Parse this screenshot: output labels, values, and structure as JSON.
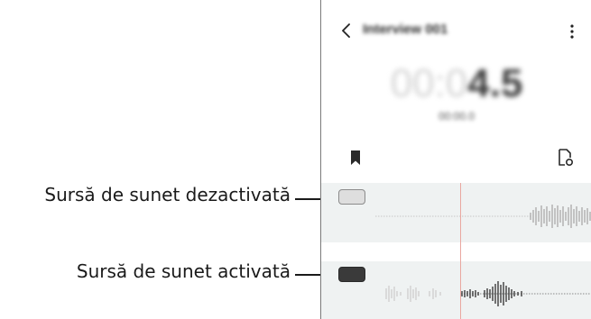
{
  "callouts": [
    {
      "text": "Sursă de sunet dezactivată"
    },
    {
      "text": "Sursă de sunet activată"
    }
  ],
  "app": {
    "title": "Interview 001",
    "timer_dim": "00:0",
    "timer_strong": "4.5",
    "subtime": "00:00.0"
  },
  "icons": {
    "back": "chevron-left-icon",
    "more": "more-vertical-icon",
    "bookmark": "bookmark-icon",
    "audio": "audio-file-icon"
  },
  "sources": [
    {
      "state": "off",
      "label_index": 0
    },
    {
      "state": "on",
      "label_index": 1
    }
  ],
  "colors": {
    "playhead": "#e9a7a0",
    "track_bg": "#eff2f2",
    "toggle_off": "#dedede",
    "toggle_on": "#3a3a3a"
  }
}
